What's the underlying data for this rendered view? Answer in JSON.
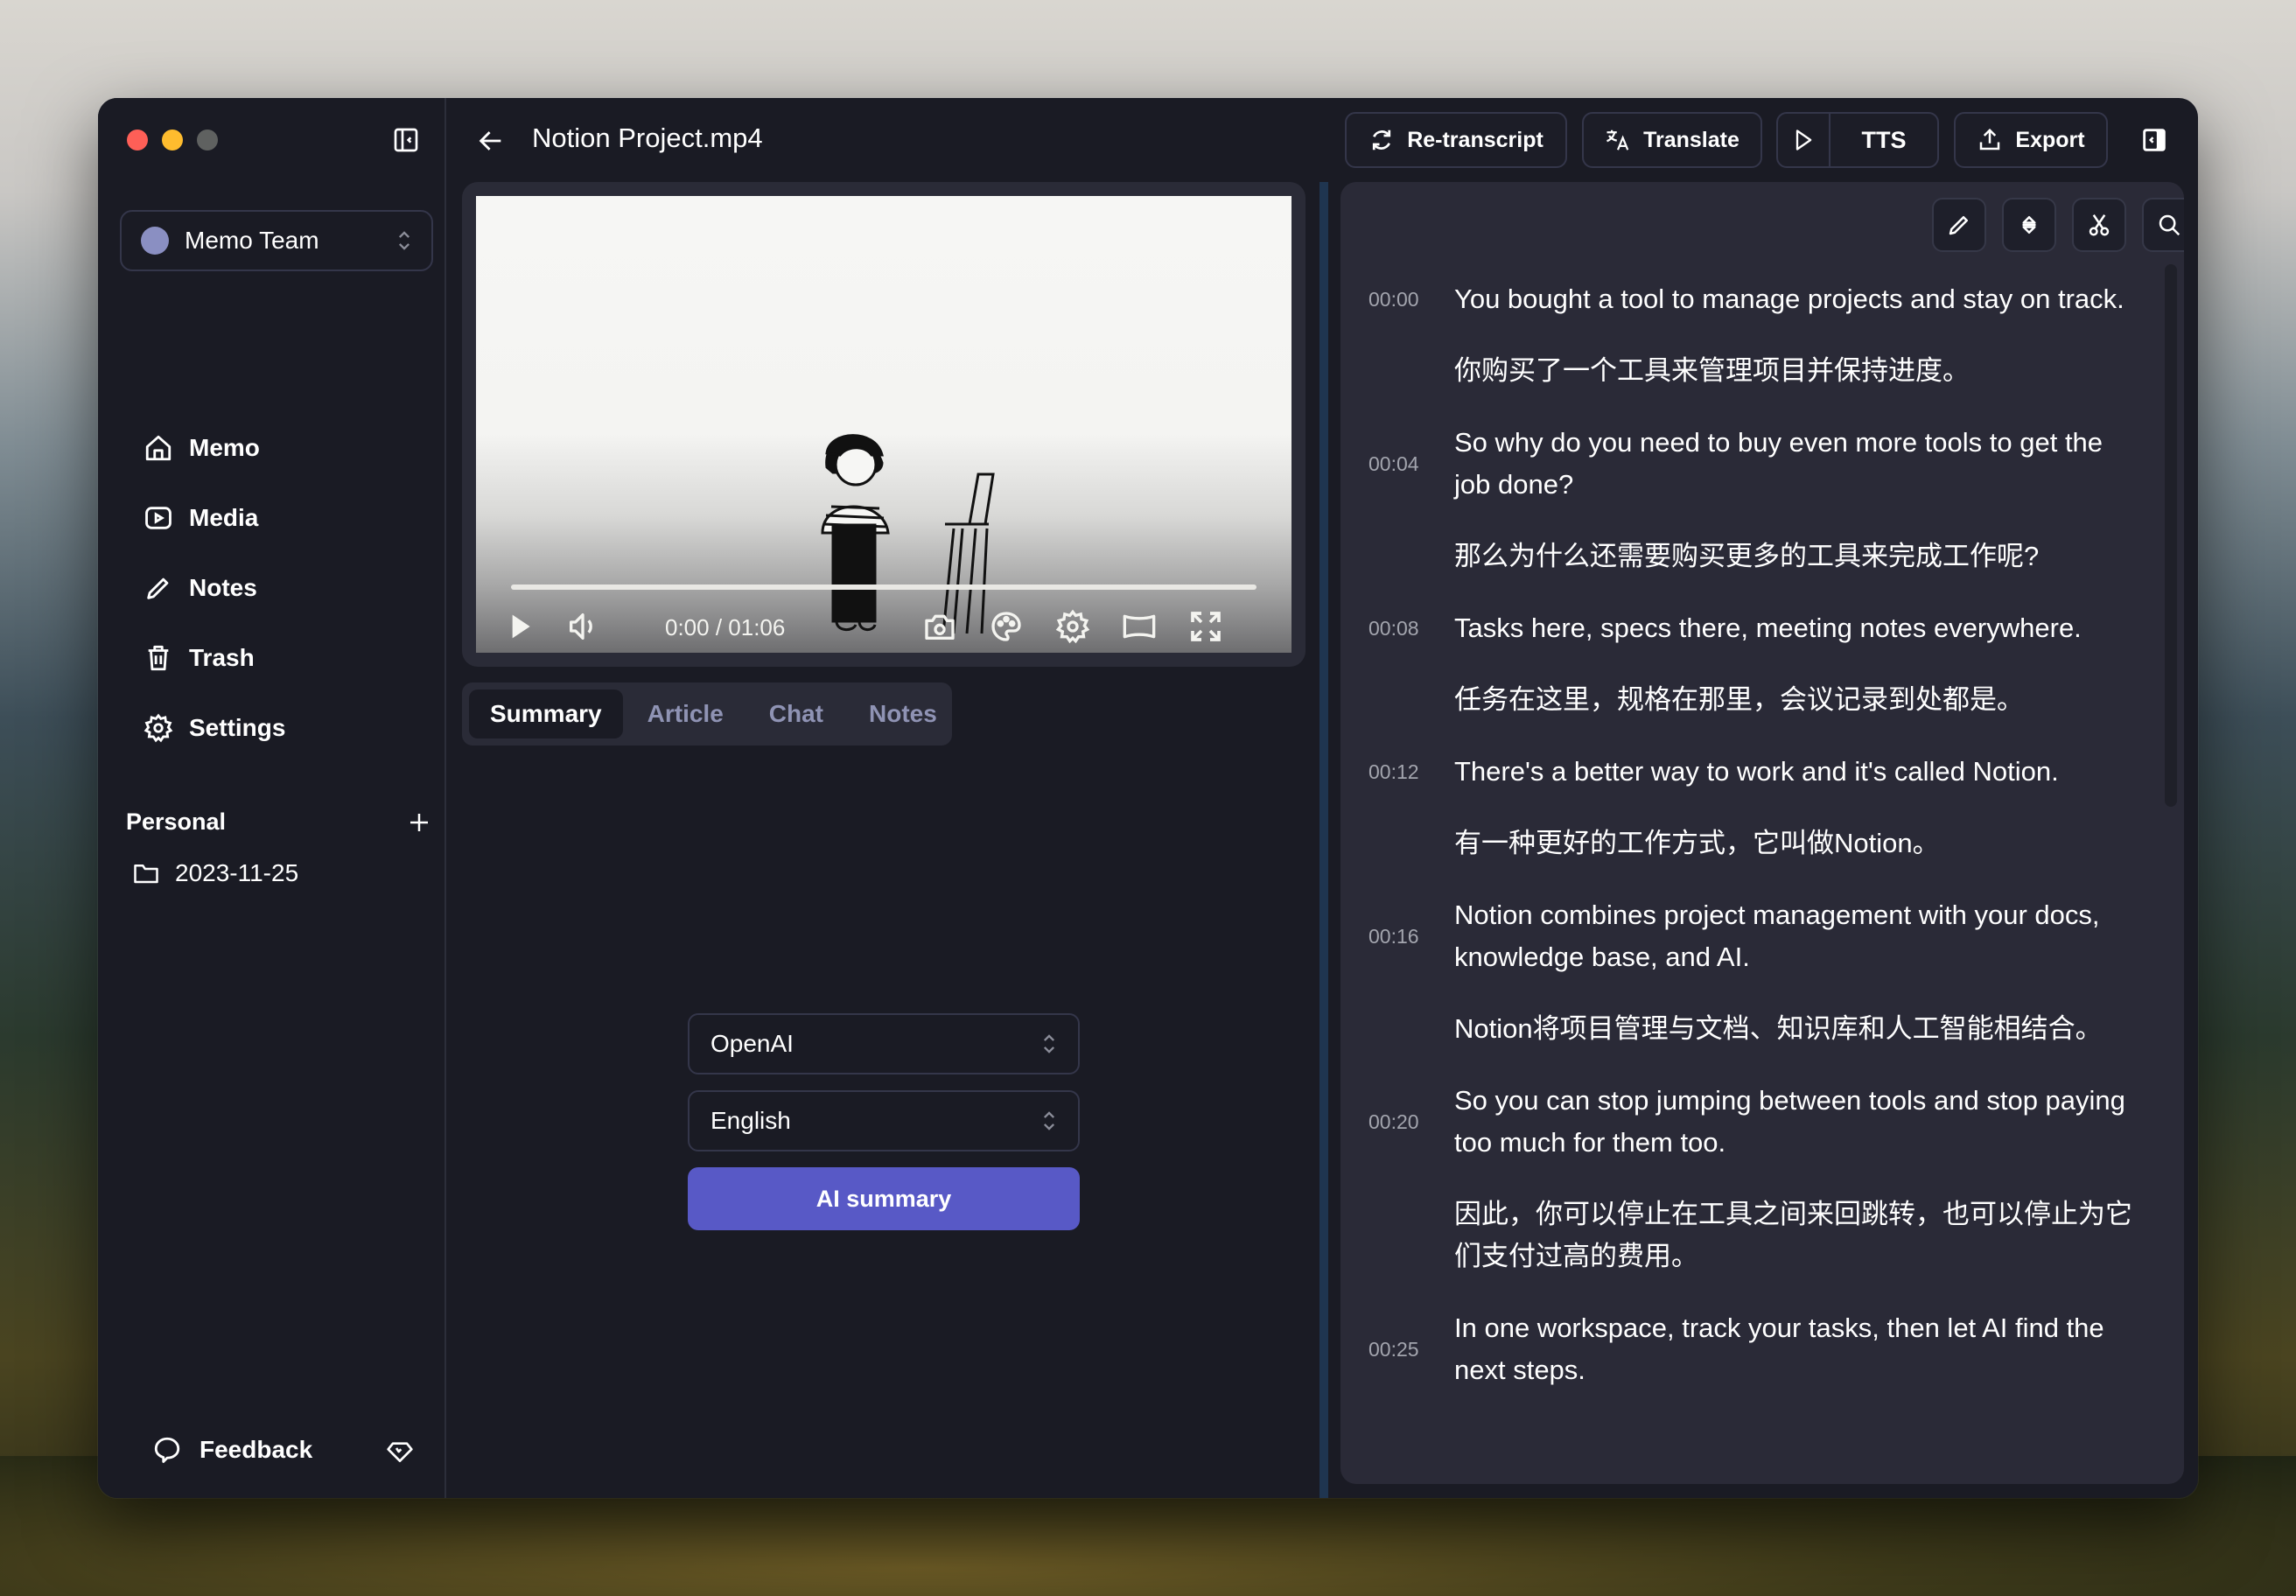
{
  "window": {
    "title": "Notion Project.mp4"
  },
  "sidebar": {
    "workspace": "Memo Team",
    "workspace_color": "#8a8fc2",
    "nav": [
      {
        "label": "Memo",
        "icon": "home-icon"
      },
      {
        "label": "Media",
        "icon": "play-square-icon"
      },
      {
        "label": "Notes",
        "icon": "pencil-icon"
      },
      {
        "label": "Trash",
        "icon": "trash-icon"
      },
      {
        "label": "Settings",
        "icon": "gear-icon"
      }
    ],
    "section_label": "Personal",
    "folders": [
      {
        "label": "2023-11-25",
        "icon": "folder-icon"
      }
    ],
    "feedback_label": "Feedback"
  },
  "toolbar": {
    "retranscript_label": "Re-transcript",
    "translate_label": "Translate",
    "tts_label": "TTS",
    "export_label": "Export"
  },
  "player": {
    "time_current": "0:00",
    "time_total": "01:06",
    "time_display": "0:00 / 01:06",
    "progress_fraction": 0
  },
  "tabs": [
    {
      "label": "Summary",
      "active": true
    },
    {
      "label": "Article",
      "active": false
    },
    {
      "label": "Chat",
      "active": false
    },
    {
      "label": "Notes",
      "active": false
    }
  ],
  "summary": {
    "provider": "OpenAI",
    "language": "English",
    "button_label": "AI summary",
    "accent_color": "#5859c6"
  },
  "transcript": {
    "tools": [
      "edit-icon",
      "expand-collapse-icon",
      "scissors-icon",
      "search-icon",
      "align-right-icon"
    ],
    "segments": [
      {
        "time": "00:00",
        "text": "You bought a tool to manage projects and stay on track.",
        "translation": "你购买了一个工具来管理项目并保持进度。"
      },
      {
        "time": "00:04",
        "text": "So why do you need to buy even more tools to get the job done?",
        "translation": "那么为什么还需要购买更多的工具来完成工作呢?"
      },
      {
        "time": "00:08",
        "text": "Tasks here, specs there, meeting notes everywhere.",
        "translation": "任务在这里，规格在那里，会议记录到处都是。"
      },
      {
        "time": "00:12",
        "text": "There's a better way to work and it's called Notion.",
        "translation": "有一种更好的工作方式，它叫做Notion。"
      },
      {
        "time": "00:16",
        "text": "Notion combines project management with your docs, knowledge base, and AI.",
        "translation": "Notion将项目管理与文档、知识库和人工智能相结合。"
      },
      {
        "time": "00:20",
        "text": "So you can stop jumping between tools and stop paying too much for them too.",
        "translation": "因此，你可以停止在工具之间来回跳转，也可以停止为它们支付过高的费用。"
      },
      {
        "time": "00:25",
        "text": "In one workspace, track your tasks, then let AI find the next steps.",
        "translation": ""
      }
    ]
  }
}
